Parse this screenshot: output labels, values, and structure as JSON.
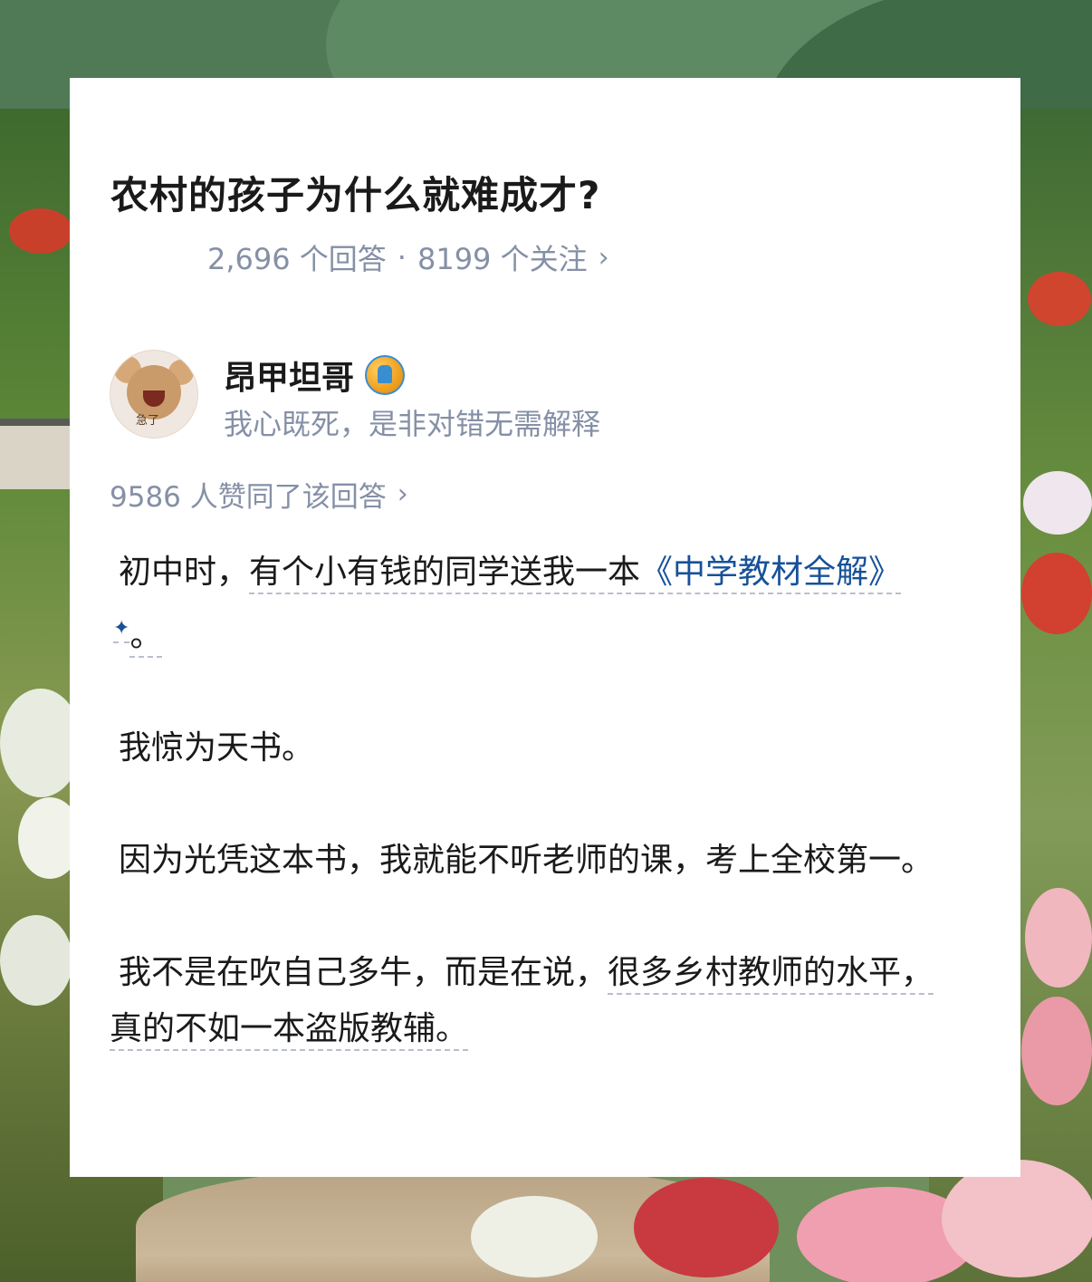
{
  "question": {
    "title": "农村的孩子为什么就难成才?",
    "answers": "2,696 个回答",
    "separator": "·",
    "followers": "8199 个关注",
    "chevron": "›"
  },
  "author": {
    "name": "昂甲坦哥",
    "bio": "我心既死，是非对错无需解释",
    "avatar_caption": "急了",
    "badge_icon": "creator-badge-icon"
  },
  "likes": {
    "text": "9586 人赞同了该回答",
    "chevron": "›"
  },
  "content": {
    "p1_part1": "初中时，",
    "p1_link_pre": "有个小有钱的同学送我一本",
    "p1_book": "《中学教材全解》",
    "p1_spark": "✦",
    "p1_end": "。",
    "p2": "我惊为天书。",
    "p3": "因为光凭这本书，我就能不听老师的课，考上全校第一。",
    "p4_part1": "我不是在吹自己多牛，而是在说，",
    "p4_underlined": "很多乡村教师的水平，真的不如一本盗版教辅。"
  },
  "colors": {
    "title": "#1a1a1a",
    "meta": "#8590a6",
    "link": "#175199",
    "card": "#ffffff"
  }
}
